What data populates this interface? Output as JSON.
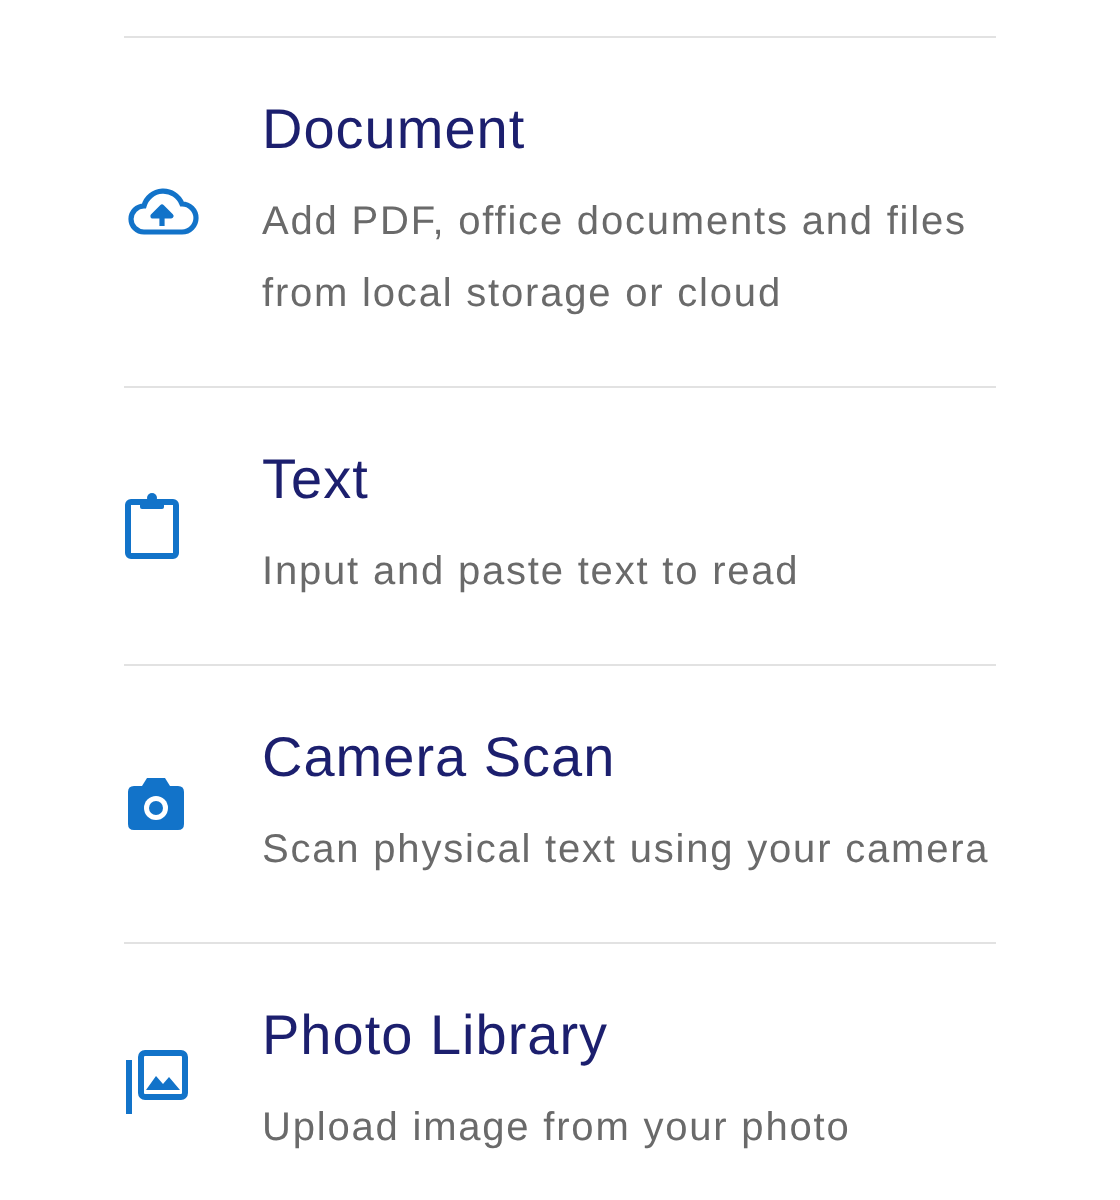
{
  "options": [
    {
      "kind": "document",
      "title": "Document",
      "description": "Add PDF, office documents and files from local storage or cloud"
    },
    {
      "kind": "text",
      "title": "Text",
      "description": "Input and paste text to read"
    },
    {
      "kind": "camera",
      "title": "Camera Scan",
      "description": "Scan physical text using your camera"
    },
    {
      "kind": "library",
      "title": "Photo Library",
      "description": "Upload image from your photo"
    }
  ]
}
